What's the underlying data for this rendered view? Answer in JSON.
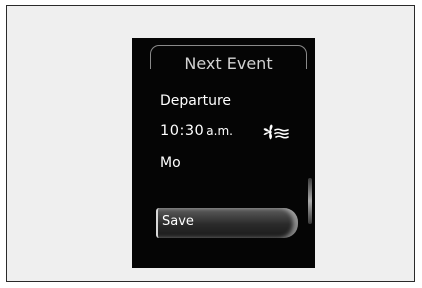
{
  "screen": {
    "title": "Next Event",
    "event_label": "Departure",
    "time": "10:30",
    "time_period": "a.m.",
    "day": "Mo",
    "mode_icon": "fan-icon",
    "save_label": "Save"
  },
  "colors": {
    "background": "#efefef",
    "screen": "#050505",
    "text": "#ffffff"
  }
}
